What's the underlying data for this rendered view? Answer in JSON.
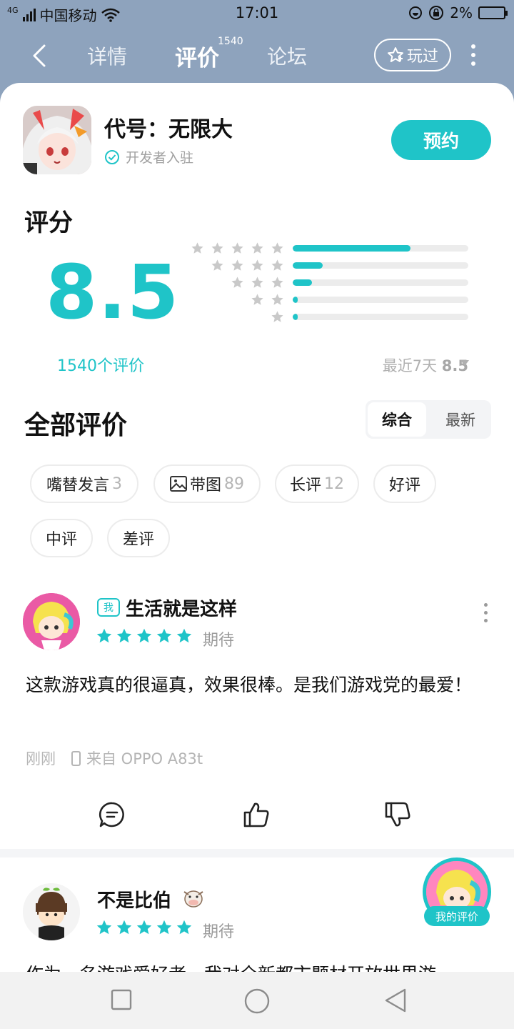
{
  "status": {
    "network": "4G",
    "carrier": "中国移动",
    "time": "17:01",
    "battery": "2%"
  },
  "nav": {
    "tabs": [
      {
        "label": "详情"
      },
      {
        "label": "评价"
      },
      {
        "label": "论坛"
      }
    ],
    "active_tab_count": "1540",
    "played_label": "玩过"
  },
  "game": {
    "title": "代号：无限大",
    "developer_badge": "开发者入驻",
    "reserve_label": "预约"
  },
  "rating": {
    "section_title": "评分",
    "score": "8.5",
    "count_label": "1540个评价",
    "recent_prefix": "最近7天",
    "recent_score": "8.5",
    "distribution": [
      {
        "stars": 5,
        "fraction": 0.67
      },
      {
        "stars": 4,
        "fraction": 0.17
      },
      {
        "stars": 3,
        "fraction": 0.11
      },
      {
        "stars": 2,
        "fraction": 0.02
      },
      {
        "stars": 1,
        "fraction": 0.03
      }
    ]
  },
  "reviews_section": {
    "title": "全部评价",
    "sort_options": [
      "综合",
      "最新"
    ],
    "filters": [
      {
        "label": "嘴替发言",
        "count": "3"
      },
      {
        "label": "带图",
        "count": "89"
      },
      {
        "label": "长评",
        "count": "12"
      },
      {
        "label": "好评",
        "count": ""
      },
      {
        "label": "中评",
        "count": ""
      },
      {
        "label": "差评",
        "count": ""
      }
    ]
  },
  "reviews": [
    {
      "badge": "我",
      "username": "生活就是这样",
      "stars": 5,
      "tag": "期待",
      "text": "这款游戏真的很逼真，效果很棒。是我们游戏党的最爱！",
      "time": "刚刚",
      "device": "来自 OPPO A83t"
    },
    {
      "username": "不是比伯",
      "stars": 5,
      "tag": "期待",
      "text": "作为一名游戏爱好者，我对全新都市题材开放世界游"
    }
  ],
  "floating": {
    "my_review_label": "我的评价"
  },
  "colors": {
    "accent": "#1fc4c8",
    "header_bg": "#8ea3bd"
  }
}
